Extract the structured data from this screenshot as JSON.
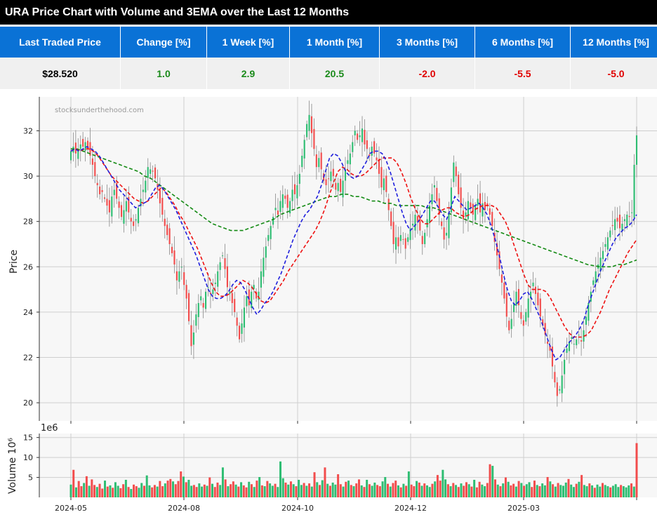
{
  "title": "URA Price Chart with Volume and 3EMA over the Last 12 Months",
  "stats": {
    "headers": [
      "Last Traded Price",
      "Change [%]",
      "1 Week [%]",
      "1 Month [%]",
      "3 Months [%]",
      "6 Months [%]",
      "12 Months [%]"
    ],
    "values": [
      "$28.520",
      "1.0",
      "2.9",
      "20.5",
      "-2.0",
      "-5.5",
      "-5.0"
    ],
    "value_colors": [
      "#000000",
      "#1a8a1a",
      "#1a8a1a",
      "#1a8a1a",
      "#e00000",
      "#e00000",
      "#e00000"
    ]
  },
  "watermark": "stocksunderthehood.com",
  "chart_data": [
    {
      "type": "candlestick",
      "ylabel": "Price",
      "ylim": [
        19.2,
        33.5
      ],
      "yticks": [
        20,
        22,
        24,
        26,
        28,
        30,
        32
      ],
      "xticks": [
        "2024-05",
        "2024-08",
        "2024-10",
        "2024-12",
        "2025-03"
      ],
      "grid": true,
      "colors": {
        "up": "#2ebd72",
        "down": "#f24c4c",
        "ema_fast": "#1f1fdd",
        "ema_mid": "#ee1111",
        "ema_slow": "#138a13"
      },
      "close": [
        31.1,
        31.3,
        31.0,
        31.2,
        31.4,
        31.3,
        31.5,
        31.2,
        30.9,
        30.5,
        30.0,
        29.6,
        29.2,
        29.3,
        29.0,
        28.7,
        28.4,
        29.1,
        29.4,
        29.0,
        28.6,
        28.2,
        28.5,
        28.9,
        28.4,
        28.0,
        27.8,
        28.1,
        28.6,
        29.0,
        29.4,
        29.8,
        30.4,
        30.3,
        30.2,
        29.9,
        29.4,
        28.8,
        28.3,
        27.8,
        27.4,
        27.0,
        26.6,
        26.1,
        25.4,
        25.8,
        26.0,
        25.2,
        24.6,
        23.6,
        22.5,
        23.1,
        23.9,
        24.4,
        24.7,
        24.2,
        24.9,
        25.1,
        24.8,
        25.0,
        25.3,
        25.8,
        26.2,
        26.5,
        25.9,
        25.1,
        24.9,
        24.4,
        24.0,
        23.4,
        22.8,
        23.5,
        24.2,
        24.7,
        24.3,
        24.9,
        25.2,
        24.6,
        24.9,
        25.8,
        26.4,
        26.9,
        27.4,
        27.8,
        28.2,
        28.6,
        28.3,
        28.9,
        29.2,
        29.0,
        28.6,
        28.9,
        29.4,
        29.2,
        29.6,
        30.1,
        30.9,
        31.6,
        32.3,
        32.7,
        31.9,
        31.2,
        30.4,
        30.8,
        30.3,
        29.8,
        29.6,
        29.9,
        30.2,
        30.0,
        29.4,
        29.7,
        29.3,
        29.8,
        30.3,
        30.7,
        31.0,
        31.5,
        32.0,
        31.6,
        31.8,
        32.1,
        31.4,
        31.2,
        30.9,
        31.3,
        31.0,
        30.7,
        30.1,
        29.5,
        29.9,
        29.3,
        28.5,
        27.8,
        27.0,
        27.3,
        26.9,
        27.4,
        27.2,
        26.8,
        27.3,
        27.7,
        27.9,
        28.3,
        28.0,
        27.6,
        27.0,
        27.5,
        28.1,
        28.7,
        29.2,
        29.6,
        28.9,
        28.3,
        27.8,
        27.2,
        27.5,
        28.4,
        29.5,
        30.6,
        30.0,
        29.2,
        28.6,
        28.1,
        28.4,
        28.9,
        28.6,
        28.3,
        28.7,
        29.0,
        28.4,
        28.8,
        28.5,
        28.7,
        28.3,
        27.8,
        27.1,
        26.5,
        25.9,
        25.3,
        24.6,
        23.8,
        23.2,
        23.7,
        24.4,
        24.9,
        24.3,
        23.7,
        23.4,
        24.0,
        24.6,
        24.9,
        25.3,
        24.8,
        24.3,
        23.8,
        23.4,
        23.0,
        22.6,
        22.3,
        21.6,
        20.9,
        20.3,
        20.6,
        21.2,
        21.9,
        22.4,
        22.7,
        22.9,
        22.6,
        22.8,
        23.0,
        22.7,
        23.2,
        23.8,
        24.4,
        24.9,
        25.4,
        25.8,
        26.1,
        26.4,
        26.7,
        27.0,
        27.3,
        27.6,
        27.8,
        28.1,
        28.0,
        27.7,
        27.9,
        28.1,
        28.3,
        28.2,
        28.4,
        30.5,
        31.8
      ],
      "ema_fast": [
        31.1,
        31.2,
        31.1,
        31.2,
        31.3,
        31.2,
        31.1,
        30.9,
        30.6,
        30.3,
        30.0,
        29.7,
        29.4,
        29.2,
        29.0,
        28.8,
        28.6,
        28.7,
        28.8,
        28.9,
        29.2,
        29.5,
        29.6,
        29.4,
        29.1,
        28.8,
        28.5,
        28.1,
        27.7,
        27.3,
        26.9,
        26.5,
        26.0,
        25.5,
        25.0,
        24.7,
        24.6,
        24.6,
        24.7,
        24.9,
        25.2,
        25.4,
        25.3,
        25.0,
        24.6,
        24.2,
        23.9,
        24.1,
        24.4,
        24.6,
        24.9,
        25.3,
        25.7,
        26.2,
        26.7,
        27.2,
        27.6,
        28.0,
        28.3,
        28.5,
        28.8,
        29.1,
        29.6,
        30.2,
        30.8,
        31.0,
        30.9,
        30.6,
        30.2,
        30.0,
        29.9,
        30.0,
        30.3,
        30.6,
        31.0,
        31.1,
        31.1,
        31.0,
        30.7,
        30.2,
        29.6,
        29.0,
        28.4,
        27.9,
        27.6,
        27.8,
        28.0,
        28.3,
        28.6,
        28.9,
        28.9,
        28.6,
        28.3,
        28.1,
        28.6,
        29.1,
        28.9,
        28.7,
        28.5,
        28.6,
        28.7,
        28.8,
        28.6,
        28.3,
        27.8,
        27.2,
        26.5,
        25.7,
        25.0,
        24.5,
        24.3,
        24.5,
        24.8,
        24.9,
        24.6,
        24.2,
        23.8,
        23.3,
        22.8,
        22.3,
        21.9,
        22.0,
        22.3,
        22.6,
        22.8,
        23.0,
        23.3,
        23.7,
        24.3,
        24.8,
        25.3,
        25.8,
        26.2,
        26.6,
        27.0,
        27.3,
        27.5,
        27.7,
        27.8,
        28.0,
        28.3
      ],
      "ema_mid": [
        31.1,
        31.2,
        31.1,
        31.2,
        31.2,
        31.1,
        30.9,
        30.6,
        30.3,
        30.0,
        29.8,
        29.6,
        29.4,
        29.2,
        29.0,
        28.9,
        28.8,
        28.9,
        29.1,
        29.3,
        29.5,
        29.3,
        29.0,
        28.7,
        28.3,
        28.0,
        27.6,
        27.2,
        26.8,
        26.3,
        25.8,
        25.3,
        24.9,
        24.7,
        24.7,
        24.8,
        25.0,
        25.2,
        25.4,
        25.3,
        25.1,
        24.8,
        24.5,
        24.4,
        24.5,
        24.8,
        25.1,
        25.4,
        25.8,
        26.1,
        26.4,
        26.7,
        27.0,
        27.3,
        27.6,
        28.0,
        28.5,
        29.1,
        29.7,
        30.2,
        30.4,
        30.3,
        30.1,
        30.0,
        30.0,
        30.1,
        30.3,
        30.5,
        30.7,
        30.8,
        30.8,
        30.8,
        30.6,
        30.2,
        29.7,
        29.1,
        28.6,
        28.2,
        27.9,
        27.9,
        28.1,
        28.3,
        28.5,
        28.6,
        28.6,
        28.4,
        28.3,
        28.2,
        28.3,
        28.5,
        28.6,
        28.7,
        28.7,
        28.7,
        28.6,
        28.3,
        28.0,
        27.5,
        26.9,
        26.3,
        25.7,
        25.2,
        25.0,
        25.0,
        25.0,
        24.9,
        24.6,
        24.2,
        23.8,
        23.4,
        23.1,
        22.9,
        22.9,
        22.9,
        23.0,
        23.2,
        23.6,
        24.0,
        24.5,
        25.0,
        25.4,
        25.8,
        26.2,
        26.6,
        26.9,
        27.2
      ],
      "ema_slow": [
        31.2,
        31.2,
        31.1,
        31.0,
        30.9,
        30.8,
        30.7,
        30.6,
        30.5,
        30.4,
        30.3,
        30.2,
        30.0,
        29.9,
        29.7,
        29.5,
        29.3,
        29.1,
        28.9,
        28.7,
        28.5,
        28.3,
        28.1,
        27.9,
        27.8,
        27.7,
        27.6,
        27.6,
        27.6,
        27.7,
        27.8,
        27.9,
        28.0,
        28.1,
        28.3,
        28.4,
        28.5,
        28.6,
        28.7,
        28.8,
        28.9,
        29.0,
        29.1,
        29.1,
        29.2,
        29.2,
        29.1,
        29.1,
        29.0,
        28.9,
        28.9,
        28.8,
        28.8,
        28.7,
        28.7,
        28.7,
        28.7,
        28.7,
        28.6,
        28.6,
        28.5,
        28.4,
        28.3,
        28.2,
        28.1,
        28.0,
        27.9,
        27.8,
        27.7,
        27.6,
        27.5,
        27.4,
        27.3,
        27.2,
        27.1,
        27.0,
        26.9,
        26.8,
        26.7,
        26.6,
        26.5,
        26.4,
        26.3,
        26.2,
        26.1,
        26.05,
        26.0,
        26.0,
        26.0,
        26.1,
        26.1,
        26.2,
        26.3
      ],
      "watermark": "stocksunderthehood.com"
    },
    {
      "type": "bar",
      "ylabel": "Volume  10⁶",
      "offset_label": "1e6",
      "ylim": [
        0,
        16
      ],
      "yticks": [
        5,
        10,
        15
      ],
      "values": [
        3.2,
        6.9,
        2.5,
        4.1,
        2.8,
        3.6,
        5.3,
        2.9,
        4.5,
        3.1,
        2.6,
        3.4,
        2.2,
        4.2,
        2.7,
        3.0,
        2.4,
        3.8,
        2.9,
        2.3,
        3.3,
        4.4,
        2.6,
        2.1,
        3.2,
        2.8,
        2.4,
        3.6,
        2.9,
        5.5,
        3.0,
        2.5,
        3.1,
        2.7,
        4.1,
        2.8,
        3.5,
        4.2,
        4.6,
        4.0,
        3.3,
        4.1,
        6.5,
        5.2,
        3.8,
        4.4,
        2.9,
        3.1,
        2.6,
        3.5,
        2.7,
        3.2,
        2.9,
        5.0,
        3.4,
        2.6,
        3.7,
        3.1,
        7.5,
        4.5,
        2.8,
        3.3,
        4.0,
        3.2,
        2.7,
        3.8,
        3.0,
        2.5,
        3.9,
        3.3,
        2.6,
        4.2,
        5.1,
        3.0,
        2.8,
        4.1,
        3.5,
        2.9,
        3.4,
        2.6,
        9.0,
        4.8,
        3.7,
        3.2,
        4.0,
        3.3,
        2.8,
        4.4,
        3.1,
        3.6,
        2.9,
        3.5,
        2.7,
        6.3,
        3.8,
        3.1,
        4.3,
        7.5,
        3.4,
        2.9,
        3.7,
        3.2,
        5.8,
        3.3,
        2.7,
        3.9,
        4.2,
        3.1,
        2.8,
        3.5,
        4.5,
        3.0,
        2.6,
        4.4,
        3.3,
        2.9,
        3.7,
        3.1,
        2.8,
        4.0,
        5.1,
        3.4,
        2.7,
        3.6,
        4.2,
        3.0,
        2.5,
        3.4,
        2.9,
        6.5,
        3.2,
        2.8,
        4.1,
        3.7,
        2.9,
        3.5,
        3.0,
        2.6,
        3.4,
        4.0,
        5.6,
        4.2,
        6.9,
        4.5,
        3.3,
        2.8,
        3.6,
        3.1,
        2.6,
        3.5,
        2.9,
        3.8,
        3.3,
        2.7,
        4.4,
        2.5,
        3.9,
        3.2,
        2.8,
        3.6,
        8.3,
        7.9,
        4.5,
        3.2,
        2.8,
        3.5,
        5.0,
        3.9,
        3.0,
        3.4,
        2.7,
        4.1,
        3.6,
        2.9,
        3.3,
        3.8,
        2.6,
        4.2,
        3.1,
        2.8,
        3.5,
        3.0,
        5.1,
        4.0,
        3.3,
        2.7,
        3.6,
        3.1,
        2.9,
        3.7,
        4.6,
        3.2,
        2.6,
        3.4,
        3.9,
        5.6,
        3.1,
        2.8,
        3.5,
        3.0,
        2.4,
        3.2,
        2.7,
        3.6,
        3.1,
        2.8,
        2.5,
        2.9,
        3.3,
        2.6,
        3.1,
        2.8,
        2.5,
        3.0,
        3.5,
        2.7,
        13.6
      ],
      "up_flags": [
        1,
        0,
        1,
        0,
        0,
        1,
        0,
        1,
        0,
        0,
        1,
        0,
        0,
        1,
        0,
        1,
        0,
        1,
        1,
        0,
        0,
        1,
        0,
        1,
        0,
        0,
        1,
        1,
        0,
        1,
        1,
        0,
        0,
        1,
        0,
        0,
        1,
        0,
        0,
        1,
        0,
        0,
        0,
        1,
        0,
        1,
        1,
        0,
        0,
        1,
        1,
        0,
        1,
        0,
        1,
        0,
        0,
        1,
        1,
        0,
        1,
        0,
        0,
        1,
        0,
        1,
        0,
        0,
        1,
        0,
        1,
        0,
        1,
        0,
        1,
        0,
        1,
        1,
        0,
        1,
        1,
        1,
        0,
        1,
        0,
        1,
        0,
        1,
        1,
        0,
        1,
        0,
        1,
        0,
        1,
        0,
        1,
        0,
        1,
        0,
        1,
        1,
        0,
        0,
        1,
        0,
        1,
        0,
        1,
        0,
        0,
        1,
        0,
        1,
        0,
        1,
        1,
        0,
        0,
        1,
        1,
        0,
        1,
        0,
        0,
        1,
        0,
        1,
        0,
        1,
        0,
        0,
        1,
        0,
        1,
        0,
        1,
        1,
        0,
        1,
        0,
        0,
        1,
        1,
        0,
        1,
        0,
        1,
        0,
        1,
        0,
        0,
        1,
        0,
        1,
        0,
        0,
        1,
        1,
        0,
        0,
        1,
        0,
        1,
        0,
        1,
        0,
        1,
        0,
        0,
        1,
        0,
        1,
        0,
        1,
        1,
        0,
        0,
        1,
        0,
        1,
        1,
        0,
        1,
        0,
        1,
        0,
        1,
        1,
        1,
        0,
        1,
        1,
        0,
        1,
        0,
        1,
        1,
        0,
        1,
        0,
        1,
        1,
        0,
        1,
        1,
        0,
        1,
        1,
        1,
        0,
        1,
        1
      ]
    }
  ]
}
